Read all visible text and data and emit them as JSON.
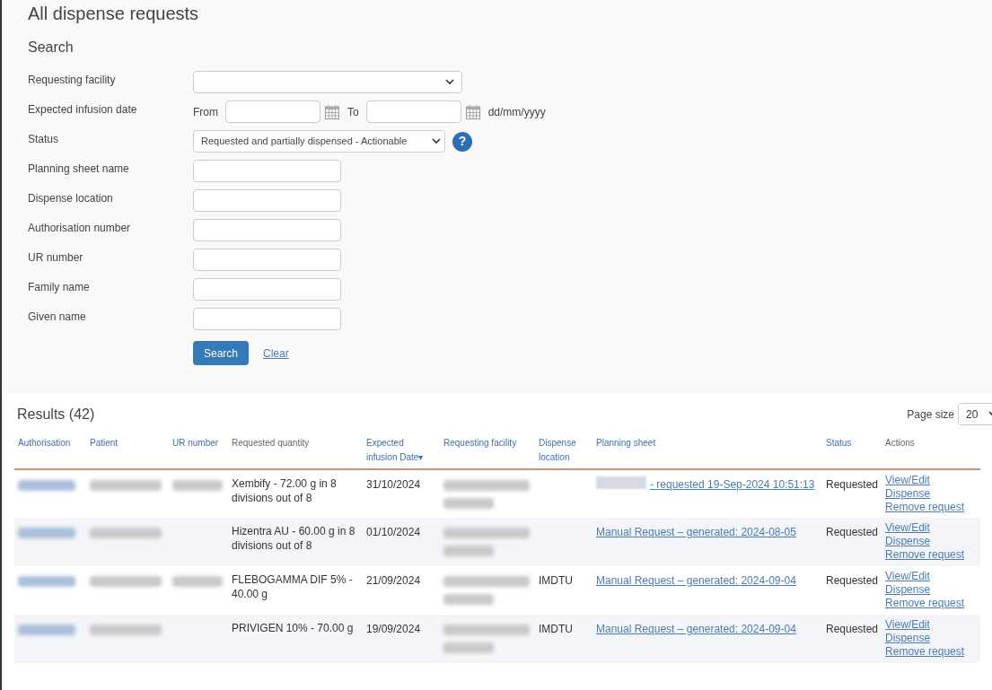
{
  "title": "All dispense requests",
  "search": {
    "heading": "Search",
    "fields": [
      {
        "kind": "select",
        "label": "Requesting facility"
      },
      {
        "kind": "daterange",
        "label": "Expected infusion date",
        "from": "From",
        "to": "To",
        "format": "dd/mm/yyyy"
      },
      {
        "kind": "status",
        "label": "Status",
        "value": "Requested and partially dispensed - Actionable",
        "help": "?"
      },
      {
        "kind": "text",
        "label": "Planning sheet name"
      },
      {
        "kind": "text",
        "label": "Dispense location"
      },
      {
        "kind": "text",
        "label": "Authorisation number"
      },
      {
        "kind": "text",
        "label": "UR number"
      },
      {
        "kind": "text",
        "label": "Family name"
      },
      {
        "kind": "text",
        "label": "Given name"
      }
    ],
    "search_button": "Search",
    "clear_link": "Clear"
  },
  "results": {
    "title": "Results (42)",
    "page_size_label": "Page size",
    "page_size": "20",
    "columns": [
      {
        "label": "Authorisation",
        "sortable": true
      },
      {
        "label": "Patient",
        "sortable": true
      },
      {
        "label": "UR number",
        "sortable": true
      },
      {
        "label": "Requested quantity",
        "sortable": false
      },
      {
        "label": "Expected infusion Date",
        "sortable": true,
        "sort_indicator": "▾"
      },
      {
        "label": "Requesting facility",
        "sortable": true
      },
      {
        "label": "Dispense location",
        "sortable": true
      },
      {
        "label": "Planning sheet",
        "sortable": true
      },
      {
        "label": "Status",
        "sortable": true
      },
      {
        "label": "Actions",
        "sortable": false
      }
    ],
    "rows": [
      {
        "authorisation_blurred": true,
        "patient_blurred": true,
        "ur_blurred": true,
        "quantity": "Xembify - 72.00 g in 8 divisions out of 8",
        "date": "31/10/2024",
        "facility_blurred": true,
        "planning_prefix_blurred": true,
        "planning": "- requested 19-Sep-2024 10:51:13",
        "status": "Requested",
        "actions": [
          "View/Edit",
          "Dispense",
          "Remove request"
        ]
      },
      {
        "authorisation_blurred": true,
        "patient_blurred": true,
        "ur_blurred": false,
        "quantity": "Hizentra AU - 60.00 g in 8 divisions out of 8",
        "date": "01/10/2024",
        "facility_blurred": true,
        "planning_prefix_blurred": false,
        "planning": "Manual Request – generated: 2024-08-05",
        "status": "Requested",
        "actions": [
          "View/Edit",
          "Dispense",
          "Remove request"
        ]
      },
      {
        "authorisation_blurred": true,
        "patient_blurred": true,
        "ur_blurred": true,
        "quantity": "FLEBOGAMMA DIF 5% - 40.00 g",
        "date": "21/09/2024",
        "facility_blurred": true,
        "location": "IMDTU",
        "planning_prefix_blurred": false,
        "planning": "Manual Request – generated: 2024-09-04",
        "status": "Requested",
        "actions": [
          "View/Edit",
          "Dispense",
          "Remove request"
        ]
      },
      {
        "authorisation_blurred": true,
        "patient_blurred": true,
        "ur_blurred": false,
        "quantity": "PRIVIGEN 10% - 70.00 g",
        "date": "19/09/2024",
        "facility_blurred": true,
        "location": "IMDTU",
        "planning_prefix_blurred": false,
        "planning": "Manual Request – generated: 2024-09-04",
        "status": "Requested",
        "actions": [
          "View/Edit",
          "Dispense",
          "Remove request"
        ]
      }
    ]
  }
}
